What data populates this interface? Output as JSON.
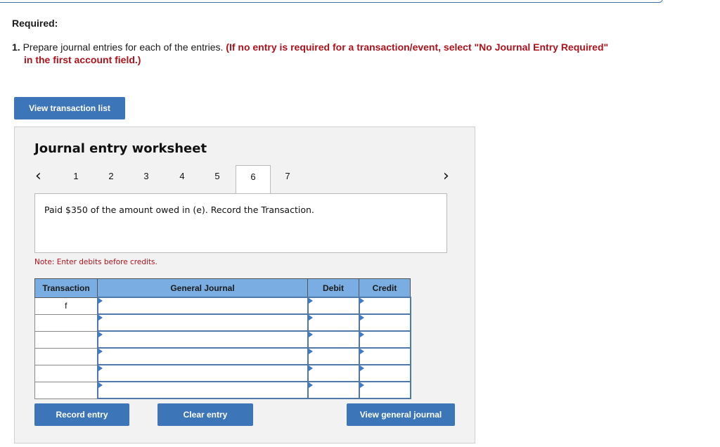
{
  "header": {
    "required_label": "Required:",
    "instruction_number": "1.",
    "instruction_text": "Prepare journal entries for each of the entries.",
    "instruction_red_line1": "(If no entry is required for a transaction/event, select \"No Journal Entry Required\"",
    "instruction_red_line2": "in the first account field.)"
  },
  "buttons": {
    "view_transaction_list": "View transaction list",
    "record_entry": "Record entry",
    "clear_entry": "Clear entry",
    "view_general_journal": "View general journal"
  },
  "worksheet": {
    "title": "Journal entry worksheet",
    "pages": [
      "1",
      "2",
      "3",
      "4",
      "5",
      "6",
      "7"
    ],
    "active_page": "6",
    "prev_icon": "chevron-left-icon",
    "next_icon": "chevron-right-icon",
    "description": "Paid $350 of the amount owed in (e). Record the Transaction.",
    "note": "Note: Enter debits before credits."
  },
  "table": {
    "headers": [
      "Transaction",
      "General Journal",
      "Debit",
      "Credit"
    ],
    "rows": [
      {
        "transaction": "f",
        "account": "",
        "debit": "",
        "credit": ""
      },
      {
        "transaction": "",
        "account": "",
        "debit": "",
        "credit": ""
      },
      {
        "transaction": "",
        "account": "",
        "debit": "",
        "credit": ""
      },
      {
        "transaction": "",
        "account": "",
        "debit": "",
        "credit": ""
      },
      {
        "transaction": "",
        "account": "",
        "debit": "",
        "credit": ""
      },
      {
        "transaction": "",
        "account": "",
        "debit": "",
        "credit": ""
      }
    ]
  },
  "colors": {
    "button_blue": "#3c75b8",
    "header_blue": "#7aaee2",
    "instruction_red": "#b0121b",
    "panel_bg": "#f2f2f2"
  }
}
